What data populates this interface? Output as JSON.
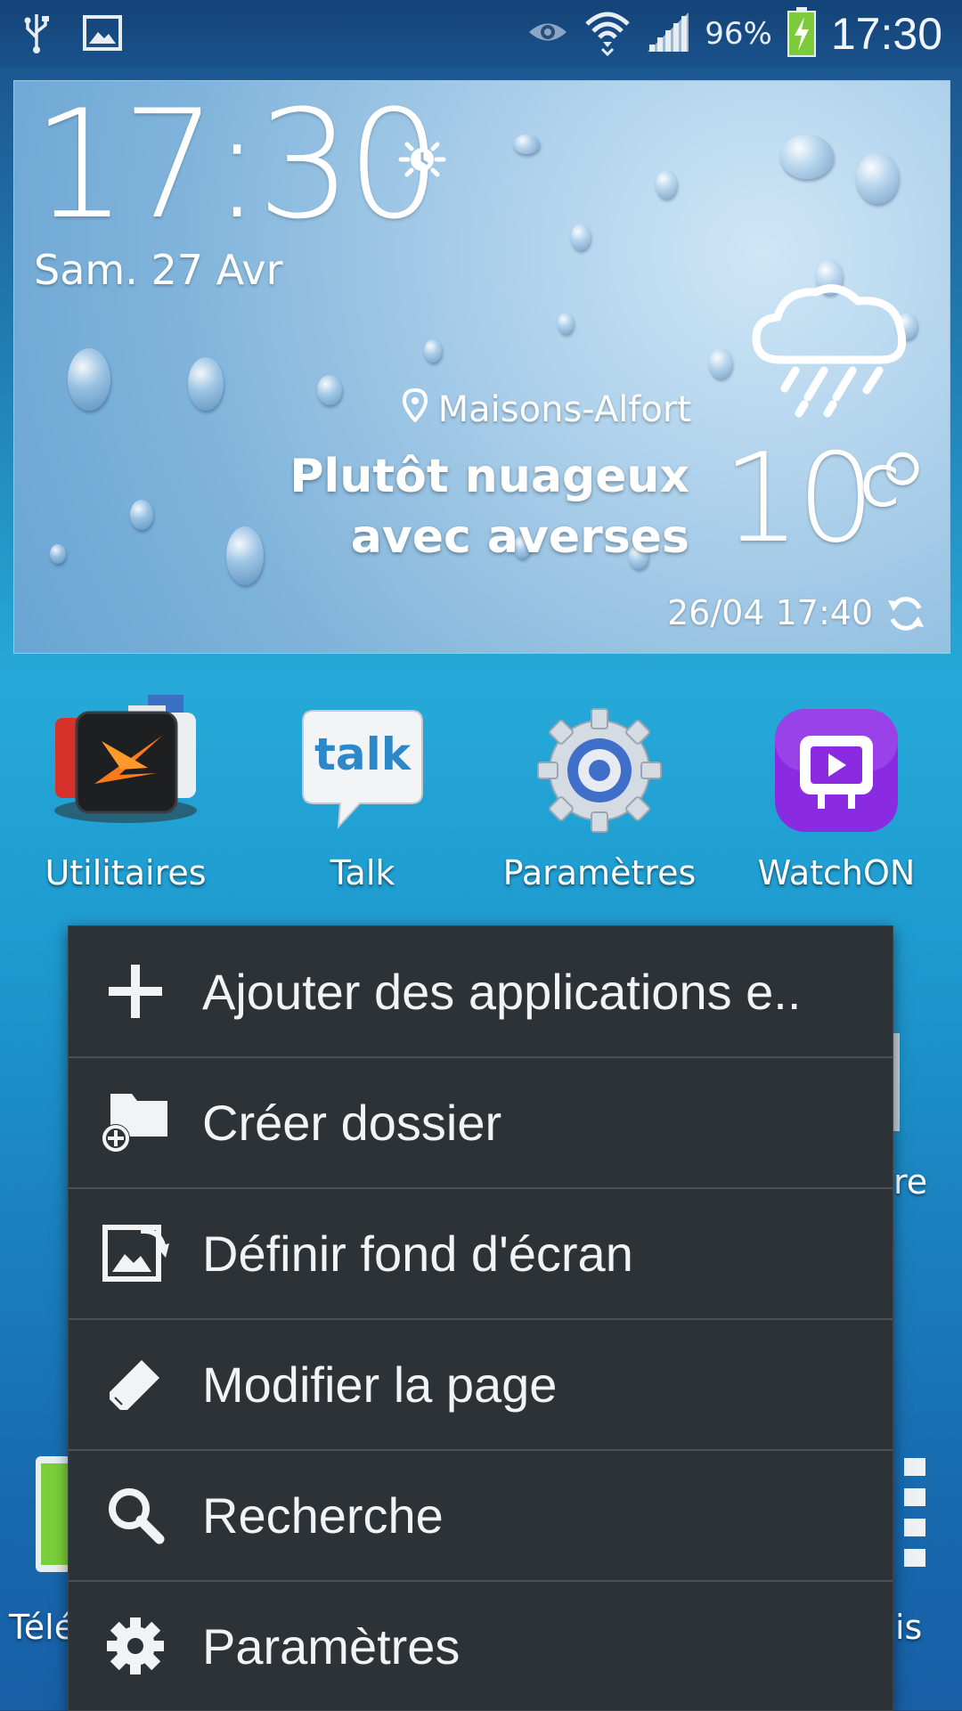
{
  "status_bar": {
    "battery_percent": "96%",
    "time": "17:30",
    "icons": [
      "usb-icon",
      "image-notification-icon",
      "smart-stay-eye-icon",
      "wifi-icon",
      "signal-icon",
      "battery-charging-icon"
    ]
  },
  "weather_widget": {
    "time": "17:30",
    "date": "Sam. 27 Avr",
    "location": "Maisons-Alfort",
    "condition": "Plutôt nuageux avec averses",
    "temperature": "10°",
    "unit": "C",
    "updated": "26/04 17:40"
  },
  "apps": [
    {
      "label": "Utilitaires",
      "icon": "folder-icon"
    },
    {
      "label": "Talk",
      "icon": "talk-icon"
    },
    {
      "label": "Paramètres",
      "icon": "settings-gear-icon"
    },
    {
      "label": "WatchON",
      "icon": "watchon-icon"
    }
  ],
  "partially_hidden": {
    "right_label_1": "re",
    "left_label_2": "Télé",
    "right_label_2": "is"
  },
  "menu": {
    "items": [
      {
        "label": "Ajouter des applications e..",
        "icon": "plus-icon"
      },
      {
        "label": "Créer dossier",
        "icon": "create-folder-icon"
      },
      {
        "label": "Définir fond d'écran",
        "icon": "wallpaper-icon"
      },
      {
        "label": "Modifier la page",
        "icon": "pencil-icon"
      },
      {
        "label": "Recherche",
        "icon": "search-icon"
      },
      {
        "label": "Paramètres",
        "icon": "gear-icon"
      }
    ]
  }
}
